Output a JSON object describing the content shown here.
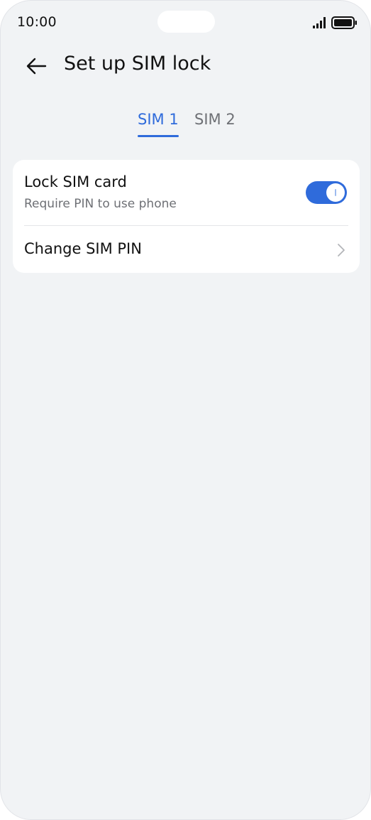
{
  "status_bar": {
    "time": "10:00",
    "signal_icon": "signal-icon",
    "battery_icon": "battery-icon"
  },
  "header": {
    "back_icon": "back-arrow-icon",
    "title": "Set up SIM lock"
  },
  "tabs": [
    {
      "label": "SIM 1",
      "selected": true
    },
    {
      "label": "SIM 2",
      "selected": false
    }
  ],
  "settings": {
    "lock_sim": {
      "title": "Lock SIM card",
      "subtitle": "Require PIN to use phone",
      "enabled": true
    },
    "change_pin": {
      "title": "Change SIM PIN",
      "icon": "chevron-right-icon"
    }
  },
  "colors": {
    "accent": "#2f6bdb",
    "background": "#f1f3f5",
    "card": "#ffffff",
    "secondary_text": "#6e7075"
  }
}
